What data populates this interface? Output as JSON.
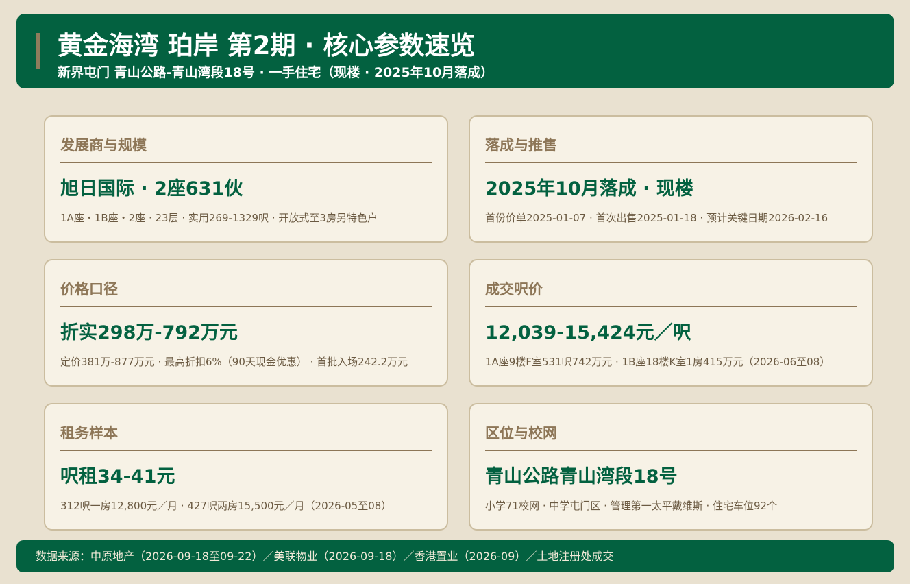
{
  "header": {
    "title": "黄金海湾 珀岸 第2期 · 核心参数速览",
    "subtitle": "新界屯门 青山公路-青山湾段18号 · 一手住宅（现楼 · 2025年10月落成）"
  },
  "cards": [
    {
      "label": "发展商与规模",
      "value": "旭日国际 · 2座631伙",
      "detail": "1A座・1B座・2座 · 23层 · 实用269-1329呎 · 开放式至3房另特色户"
    },
    {
      "label": "落成与推售",
      "value": "2025年10月落成 · 现楼",
      "detail": "首份价单2025-01-07 · 首次出售2025-01-18 · 预计关键日期2026-02-16"
    },
    {
      "label": "价格口径",
      "value": "折实298万-792万元",
      "detail": "定价381万-877万元 · 最高折扣6%（90天现金优惠） · 首批入场242.2万元"
    },
    {
      "label": "成交呎价",
      "value": "12,039-15,424元／呎",
      "detail": "1A座9楼F室531呎742万元 · 1B座18楼K室1房415万元（2026-06至08）"
    },
    {
      "label": "租务样本",
      "value": "呎租34-41元",
      "detail": "312呎一房12,800元／月 · 427呎两房15,500元／月（2026-05至08）"
    },
    {
      "label": "区位与校网",
      "value": "青山公路青山湾段18号",
      "detail": "小学71校网 · 中学屯门区 · 管理第一太平戴维斯 · 住宅车位92个"
    }
  ],
  "footer": {
    "source": "数据来源：中原地产（2026-09-18至09-22）／美联物业（2026-09-18）／香港置业（2026-09）／土地注册处成交"
  },
  "colors": {
    "brand_green": "#036140",
    "accent_brown": "#8d7657",
    "background": "#e9e1d0",
    "card_background": "#f7f2e6"
  }
}
